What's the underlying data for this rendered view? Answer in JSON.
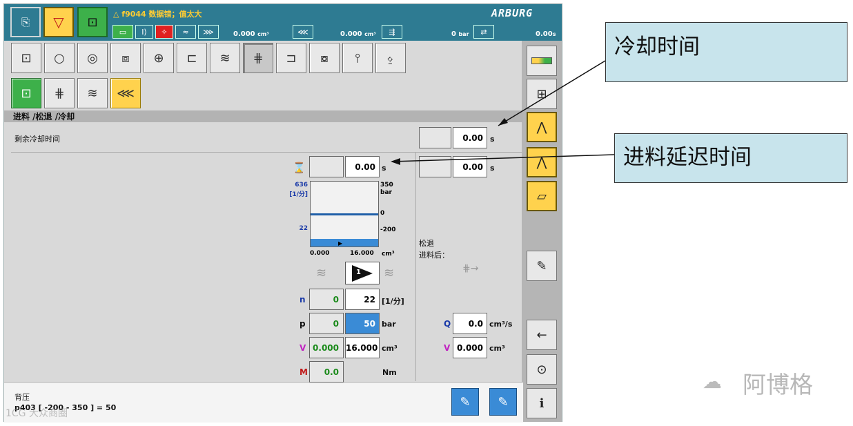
{
  "header": {
    "alarm_text": "△ f9044 数据错；值太大",
    "logo": "ARBURG",
    "values": [
      "0.000",
      "0.000",
      "0",
      "0.00"
    ],
    "value_units": [
      "cm³",
      "cm³",
      "bar",
      "s"
    ]
  },
  "breadcrumb": "进料 /松退 /冷却",
  "cooling": {
    "label": "剩余冷却时间",
    "value": "0.00",
    "unit": "s"
  },
  "delay": {
    "value": "0.00",
    "unit": "s",
    "right_value": "0.00",
    "right_unit": "s"
  },
  "gauge": {
    "left_top": "636",
    "left_unit": "[1/分]",
    "left_bottom": "22",
    "right_top": "350",
    "right_unit": "bar",
    "right_mid": "0",
    "right_bottom": "-200",
    "x_min": "0.000",
    "x_max": "16.000",
    "x_unit": "cm³",
    "level_fraction": 0.12
  },
  "step_label": "1",
  "retract": {
    "line1": "松退",
    "line2": "进料后："
  },
  "params": [
    {
      "letter": "n",
      "letter_color": "#1a3aa8",
      "actual": "0",
      "set": "22",
      "unit": "[1/分]"
    },
    {
      "letter": "p",
      "letter_color": "#111111",
      "actual": "0",
      "set": "50",
      "unit": "bar"
    },
    {
      "letter": "V",
      "letter_color": "#c020c0",
      "actual": "0.000",
      "set": "16.000",
      "unit": "cm³"
    },
    {
      "letter": "M",
      "letter_color": "#c01818",
      "actual": "0.0",
      "set": "",
      "unit": "Nm"
    }
  ],
  "retract_params": [
    {
      "letter": "Q",
      "letter_color": "#1a3aa8",
      "set": "0.0",
      "unit": "cm³/s"
    },
    {
      "letter": "V",
      "letter_color": "#c020c0",
      "set": "0.000",
      "unit": "cm³"
    }
  ],
  "footer": {
    "line1": "背压",
    "line2": "p403 [ -200 - 350 ] = 50"
  },
  "callouts": {
    "cool_time": "冷却时间",
    "feed_delay": "进料延迟时间"
  },
  "watermark": "阿博格",
  "watermark_small": "1CG 大众商圈",
  "colors": {
    "header": "#2e7b92",
    "accent_yellow": "#ffd24d",
    "accent_green": "#3db04a",
    "selected": "#3a8bd6"
  }
}
